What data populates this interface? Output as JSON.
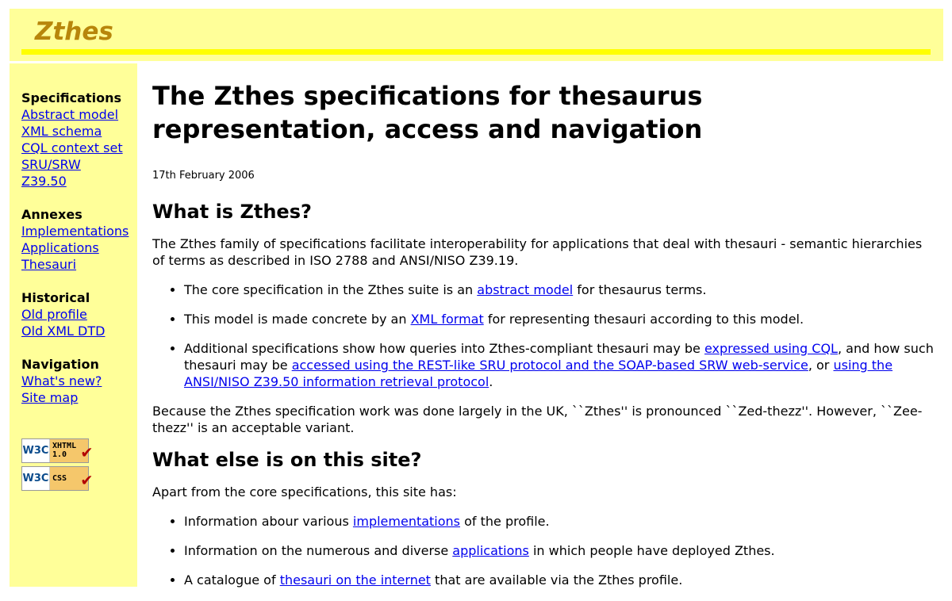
{
  "header": {
    "logo": "Zthes"
  },
  "sidebar": {
    "groups": [
      {
        "title": "Specifications",
        "links": [
          "Abstract model",
          "XML schema",
          "CQL context set",
          "SRU/SRW",
          "Z39.50"
        ]
      },
      {
        "title": "Annexes",
        "links": [
          "Implementations",
          "Applications",
          "Thesauri"
        ]
      },
      {
        "title": "Historical",
        "links": [
          "Old profile",
          "Old XML DTD"
        ]
      },
      {
        "title": "Navigation",
        "links": [
          "What's new?",
          "Site map"
        ]
      }
    ],
    "badges": [
      {
        "org": "W3C",
        "kind": "XHTML 1.0"
      },
      {
        "org": "W3C",
        "kind": "CSS"
      }
    ]
  },
  "main": {
    "title": "The Zthes specifications for thesaurus representation, access and navigation",
    "date": "17th February 2006",
    "section1": {
      "heading": "What is Zthes?",
      "intro": "The Zthes family of specifications facilitate interoperability for applications that deal with thesauri - semantic hierarchies of terms as described in ISO 2788 and ANSI/NISO Z39.19.",
      "bullets": [
        {
          "pre": "The core specification in the Zthes suite is an ",
          "link": "abstract model",
          "post": " for thesaurus terms."
        },
        {
          "pre": "This model is made concrete by an ",
          "link": "XML format",
          "post": " for representing thesauri according to this model."
        },
        {
          "pre": "Additional specifications show how queries into Zthes-compliant thesauri may be ",
          "link1": "expressed using CQL",
          "mid1": ", and how such thesauri may be ",
          "link2": "accessed using the REST-like SRU protocol and the SOAP-based SRW web-service",
          "mid2": ", or ",
          "link3": "using the ANSI/NISO Z39.50 information retrieval protocol",
          "post": "."
        }
      ],
      "pronounce": "Because the Zthes specification work was done largely in the UK, ``Zthes'' is pronounced ``Zed-thezz''. However, ``Zee-thezz'' is an acceptable variant."
    },
    "section2": {
      "heading": "What else is on this site?",
      "intro": "Apart from the core specifications, this site has:",
      "bullets": [
        {
          "pre": "Information abour various ",
          "link": "implementations",
          "post": " of the profile."
        },
        {
          "pre": "Information on the numerous and diverse ",
          "link": "applications",
          "post": " in which people have deployed Zthes."
        },
        {
          "pre": "A catalogue of ",
          "link": "thesauri on the internet",
          "post": " that are available via the Zthes profile."
        }
      ]
    }
  }
}
